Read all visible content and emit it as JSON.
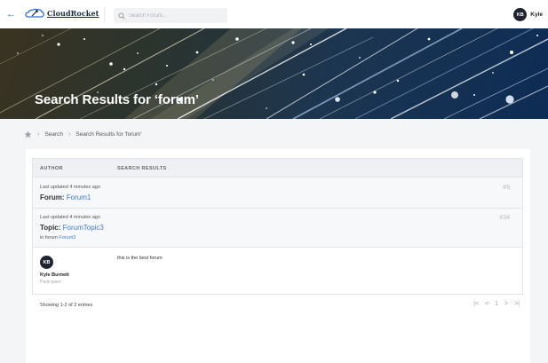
{
  "header": {
    "back_icon": "arrow-left-icon",
    "logo_text": "CloudRocket",
    "search_placeholder": "Search Forum...",
    "user_initials": "KB",
    "user_name": "Kyle"
  },
  "banner": {
    "title": "Search Results for ‘forum’"
  },
  "breadcrumb": {
    "home_icon": "star-icon",
    "items": [
      "Search",
      "Search Results for 'forum'"
    ]
  },
  "table": {
    "columns": [
      "AUTHOR",
      "SEARCH RESULTS"
    ],
    "rows": [
      {
        "meta": "Last updated 4 minutes ago",
        "type_label": "Forum:",
        "title_link": "Forum1",
        "number": "#9"
      },
      {
        "meta": "Last updated 4 minutes ago",
        "type_label": "Topic:",
        "title_link": "ForumTopic3",
        "in_forum_prefix": "in forum",
        "in_forum_link": "Forum3",
        "number": "#34"
      }
    ],
    "reply": {
      "initials": "KB",
      "name": "Kyle Burnett",
      "role": "Participant",
      "text": "this is the best forum"
    }
  },
  "footer": {
    "count_text": "Showing 1-2 of 2 entries",
    "pager": {
      "first": "|<",
      "prev": "<",
      "page": "1",
      "next": ">",
      "last": ">|"
    }
  },
  "colors": {
    "accent": "#3f7ad8",
    "dark_avatar": "#1f2430"
  }
}
